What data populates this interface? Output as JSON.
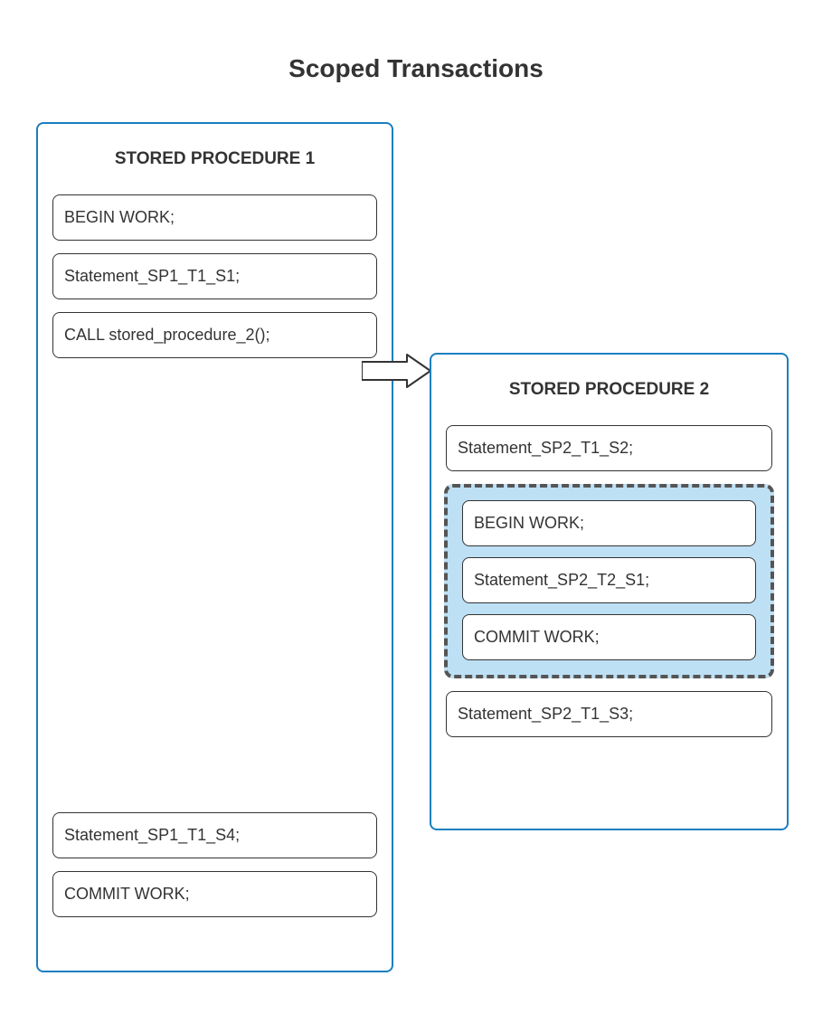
{
  "title": "Scoped Transactions",
  "proc1": {
    "title": "STORED PROCEDURE 1",
    "s1": "BEGIN WORK;",
    "s2": "Statement_SP1_T1_S1;",
    "s3": "CALL stored_procedure_2();",
    "s4": "Statement_SP1_T1_S4;",
    "s5": "COMMIT WORK;"
  },
  "proc2": {
    "title": "STORED PROCEDURE 2",
    "s1": "Statement_SP2_T1_S2;",
    "scoped": {
      "s1": "BEGIN WORK;",
      "s2": "Statement_SP2_T2_S1;",
      "s3": "COMMIT WORK;"
    },
    "s2": "Statement_SP2_T1_S3;"
  },
  "colors": {
    "border_blue": "#1b7ec1",
    "scope_fill": "#bde0f5",
    "text": "#333333"
  }
}
